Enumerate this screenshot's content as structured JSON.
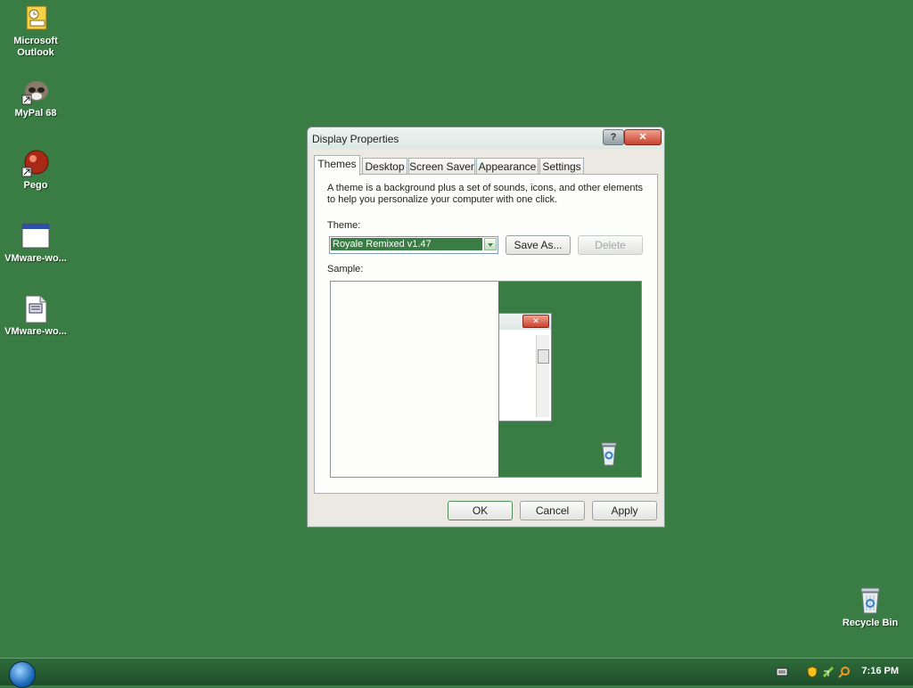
{
  "desktop": {
    "icons": [
      {
        "label_line1": "Microsoft",
        "label_line2": "Outlook",
        "icon": "outlook-icon"
      },
      {
        "label_line1": "MyPal 68",
        "label_line2": "",
        "icon": "mypal-icon"
      },
      {
        "label_line1": "Pego",
        "label_line2": "",
        "icon": "pego-icon"
      },
      {
        "label_line1": "VMware-wo...",
        "label_line2": "",
        "icon": "window-app-icon"
      },
      {
        "label_line1": "VMware-wo...",
        "label_line2": "",
        "icon": "document-icon"
      },
      {
        "label_line1": "Recycle Bin",
        "label_line2": "",
        "icon": "recycle-bin-icon"
      }
    ]
  },
  "dialog": {
    "title": "Display Properties",
    "help_label": "?",
    "close_label": "✕",
    "tabs": [
      {
        "label": "Themes",
        "active": true
      },
      {
        "label": "Desktop",
        "active": false
      },
      {
        "label": "Screen Saver",
        "active": false
      },
      {
        "label": "Appearance",
        "active": false
      },
      {
        "label": "Settings",
        "active": false
      }
    ],
    "description": "A theme is a background plus a set of sounds, icons, and other elements to help you personalize your computer with one click.",
    "theme_label": "Theme:",
    "theme_value": "Royale Remixed v1.47",
    "save_as_label": "Save As...",
    "delete_label": "Delete",
    "sample_label": "Sample:",
    "ok_label": "OK",
    "cancel_label": "Cancel",
    "apply_label": "Apply"
  },
  "taskbar": {
    "clock": "7:16 PM"
  },
  "colors": {
    "desktop_bg": "#3a7d44",
    "selection": "#3a7d44",
    "close_red": "#c7432f"
  }
}
